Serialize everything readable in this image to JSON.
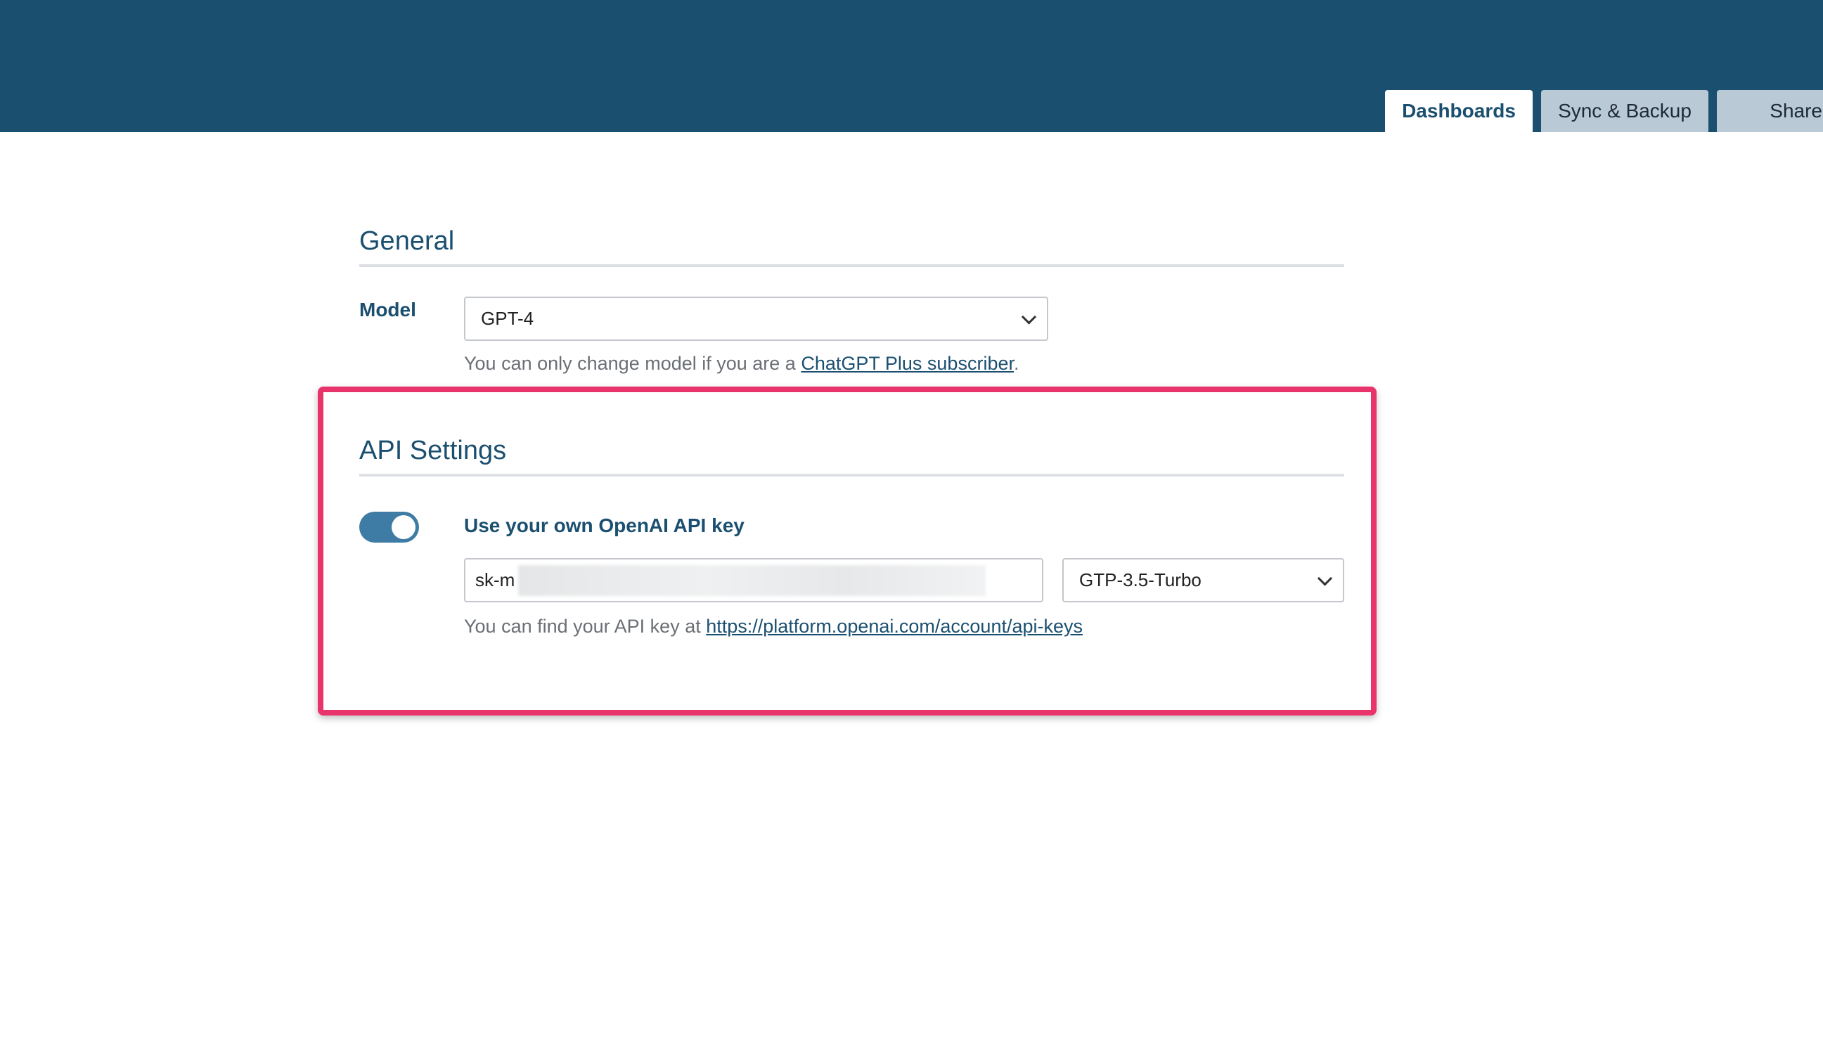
{
  "header": {
    "tabs": [
      {
        "label": "Dashboards",
        "active": true
      },
      {
        "label": "Sync & Backup",
        "active": false
      },
      {
        "label": "Share",
        "active": false
      }
    ]
  },
  "general": {
    "title": "General",
    "model_label": "Model",
    "model_value": "GPT-4",
    "help_prefix": "You can only change model if you are a ",
    "help_link": "ChatGPT Plus subscriber",
    "help_suffix": "."
  },
  "api_settings": {
    "title": "API Settings",
    "toggle_on": true,
    "toggle_label": "Use your own OpenAI API key",
    "key_value": "sk-m",
    "api_model_value": "GTP-3.5-Turbo",
    "help_prefix": "You can find your API key at ",
    "help_link": "https://platform.openai.com/account/api-keys"
  },
  "colors": {
    "header_bg": "#1b4f70",
    "accent": "#1b4f70",
    "highlight": "#e8336b",
    "toggle_on": "#3e7ca6"
  }
}
